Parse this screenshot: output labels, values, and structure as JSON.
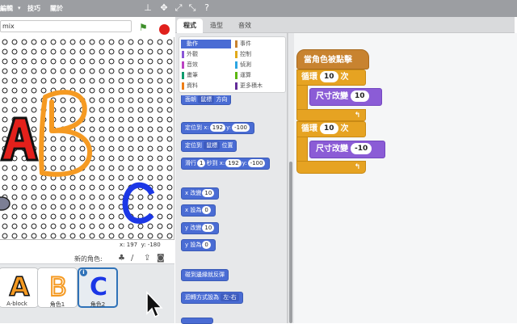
{
  "menu": {
    "items": [
      "編輯",
      "技巧",
      "關於"
    ]
  },
  "toolbar": {
    "icons": [
      "stamp-icon",
      "move-icon",
      "expand-icon",
      "shrink-icon",
      "help-icon"
    ]
  },
  "project": {
    "title": "mix"
  },
  "stage": {
    "coord_x_label": "x:",
    "coord_x": "197",
    "coord_y_label": "y:",
    "coord_y": "-180"
  },
  "sprites": {
    "new_sprite_label": "新的角色:",
    "items": [
      {
        "name": "A-block",
        "letter": "A"
      },
      {
        "name": "角色1",
        "letter": "B"
      },
      {
        "name": "角色2",
        "letter": "C"
      }
    ]
  },
  "tabs": [
    "程式",
    "造型",
    "音效"
  ],
  "categories": [
    {
      "label": "動作",
      "color": "#4a6cd4"
    },
    {
      "label": "事件",
      "color": "#c88330"
    },
    {
      "label": "外觀",
      "color": "#8a55d7"
    },
    {
      "label": "控制",
      "color": "#e1a91a"
    },
    {
      "label": "音效",
      "color": "#bb42c3"
    },
    {
      "label": "偵測",
      "color": "#2ca5e2"
    },
    {
      "label": "畫筆",
      "color": "#0e9a6c"
    },
    {
      "label": "運算",
      "color": "#5cb712"
    },
    {
      "label": "資料",
      "color": "#ee7d16"
    },
    {
      "label": "更多積木",
      "color": "#632d99"
    }
  ],
  "palette": {
    "b_face": {
      "t1": "面朝",
      "d1": "鼠標",
      "t2": "方向"
    },
    "b_goto_xy": {
      "t1": "定位到 x:",
      "x": "192",
      "t2": "y:",
      "y": "-100"
    },
    "b_goto": {
      "t1": "定位到",
      "d1": "鼠標",
      "t2": "位置"
    },
    "b_glide": {
      "t1": "滑行",
      "n": "1",
      "t2": "秒到 x:",
      "x": "192",
      "t3": "y:",
      "y": "-100"
    },
    "b_changex": {
      "t1": "x 改變",
      "v": "10"
    },
    "b_setx": {
      "t1": "x 設為",
      "v": "0"
    },
    "b_changey": {
      "t1": "y 改變",
      "v": "10"
    },
    "b_sety": {
      "t1": "y 設為",
      "v": "0"
    },
    "b_bounce": {
      "t1": "碰到邊緣就反彈"
    },
    "b_rotation": {
      "t1": "迴轉方式設為",
      "d1": "左-右"
    }
  },
  "script": {
    "hat": "當角色被點擊",
    "loop1": {
      "label1": "循環",
      "count": "10",
      "label2": "次"
    },
    "size1": {
      "label": "尺寸改變",
      "value": "10"
    },
    "loop2": {
      "label1": "循環",
      "count": "10",
      "label2": "次"
    },
    "size2": {
      "label": "尺寸改變",
      "value": "-10"
    }
  },
  "colors": {
    "motion": "#4a6cd4",
    "events_hat": "#c88330",
    "control": "#e6a322",
    "looks": "#8b5cd6"
  }
}
